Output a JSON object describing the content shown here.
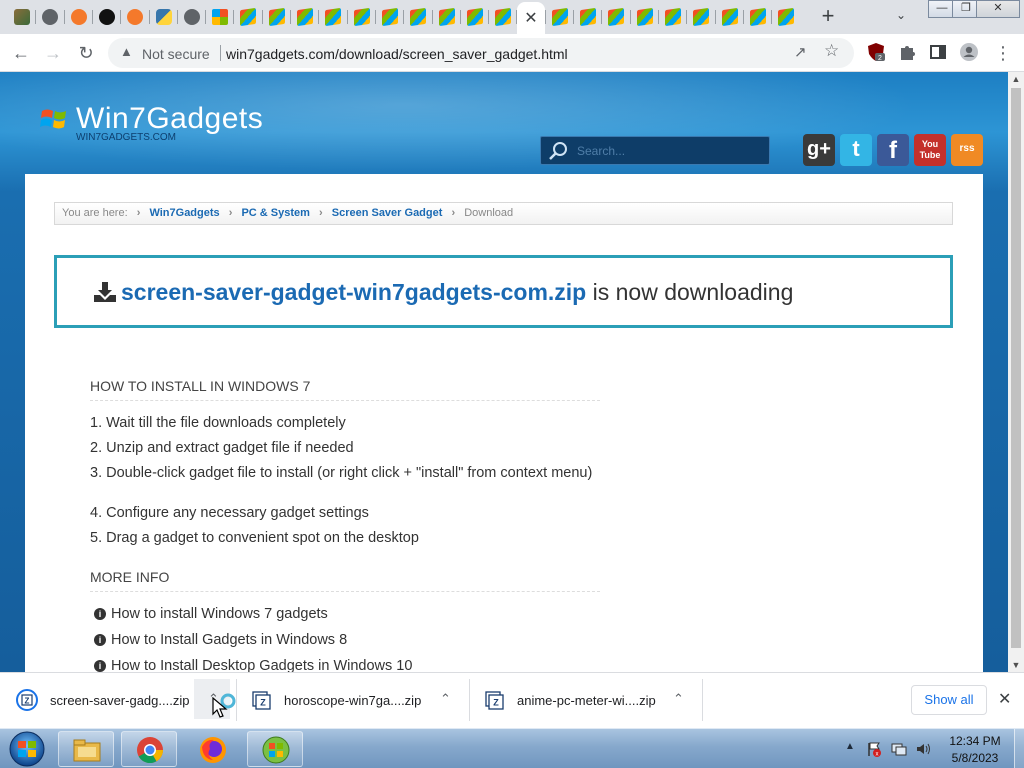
{
  "browser": {
    "tabs": [
      {
        "icon": "misc-favicon-icon"
      },
      {
        "icon": "globe-favicon-icon"
      },
      {
        "icon": "gear-favicon-icon"
      },
      {
        "icon": "github-favicon-icon"
      },
      {
        "icon": "gear-favicon-icon"
      },
      {
        "icon": "python-favicon-icon"
      },
      {
        "icon": "globe-favicon-icon"
      },
      {
        "icon": "windows-favicon-icon"
      },
      {
        "icon": "win7gadgets-favicon-icon"
      },
      {
        "icon": "win7gadgets-favicon-icon"
      },
      {
        "icon": "win7gadgets-favicon-icon"
      },
      {
        "icon": "win7gadgets-favicon-icon"
      },
      {
        "icon": "win7gadgets-favicon-icon"
      },
      {
        "icon": "win7gadgets-favicon-icon"
      },
      {
        "icon": "win7gadgets-favicon-icon"
      },
      {
        "icon": "win7gadgets-favicon-icon"
      },
      {
        "icon": "win7gadgets-favicon-icon"
      },
      {
        "icon": "win7gadgets-favicon-icon"
      },
      {
        "icon": "close-icon",
        "active": true
      },
      {
        "icon": "win7gadgets-favicon-icon"
      },
      {
        "icon": "win7gadgets-favicon-icon"
      },
      {
        "icon": "win7gadgets-favicon-icon"
      },
      {
        "icon": "win7gadgets-favicon-icon"
      },
      {
        "icon": "win7gadgets-favicon-icon"
      },
      {
        "icon": "win7gadgets-favicon-icon"
      },
      {
        "icon": "win7gadgets-favicon-icon"
      },
      {
        "icon": "win7gadgets-favicon-icon"
      },
      {
        "icon": "win7gadgets-favicon-icon"
      }
    ],
    "new_tab_label": "+",
    "security_label": "Not secure",
    "url": "win7gadgets.com/download/screen_saver_gadget.html",
    "extension_badge": "2"
  },
  "site": {
    "logo_text": "Win7Gadgets",
    "logo_subtext": "WIN7GADGETS.COM",
    "search_placeholder": "Search...",
    "social": [
      {
        "name": "google-plus",
        "label": "g+",
        "color": "#3a3a3a"
      },
      {
        "name": "twitter",
        "label": "t",
        "color": "#33b5e5"
      },
      {
        "name": "facebook",
        "label": "f",
        "color": "#3b5998"
      },
      {
        "name": "youtube",
        "label": "You Tube",
        "color": "#c4302b"
      },
      {
        "name": "rss",
        "label": "rss",
        "color": "#f08a24"
      }
    ]
  },
  "breadcrumb": {
    "prefix": "You are here:",
    "items": [
      "Win7Gadgets",
      "PC & System",
      "Screen Saver Gadget"
    ],
    "current": "Download"
  },
  "download_banner": {
    "filename": "screen-saver-gadget-win7gadgets-com.zip",
    "status_text": " is now downloading"
  },
  "install_section": {
    "heading": "HOW TO INSTALL IN WINDOWS 7",
    "steps": [
      "1. Wait till the file downloads completely",
      "2. Unzip and extract gadget file if needed",
      "3. Double-click gadget file to install (or right click + \"install\" from context menu)",
      "4. Configure any necessary gadget settings",
      "5. Drag a gadget to convenient spot on the desktop"
    ]
  },
  "more_info": {
    "heading": "MORE INFO",
    "links": [
      "How to install Windows 7 gadgets",
      "How to Install Gadgets in Windows 8",
      "How to Install Desktop Gadgets in Windows 10"
    ]
  },
  "downloads_shelf": {
    "items": [
      {
        "name": "screen-saver-gadg....zip",
        "in_progress": true
      },
      {
        "name": "horoscope-win7ga....zip"
      },
      {
        "name": "anime-pc-meter-wi....zip"
      }
    ],
    "show_all_label": "Show all"
  },
  "taskbar": {
    "apps": [
      "file-explorer",
      "chrome",
      "firefox",
      "win7gadgets"
    ],
    "clock_time": "12:34 PM",
    "clock_date": "5/8/2023"
  },
  "colors": {
    "link_blue": "#1b6ab3",
    "banner_border": "#2b9fb7",
    "site_background": "#1d7fc3"
  }
}
